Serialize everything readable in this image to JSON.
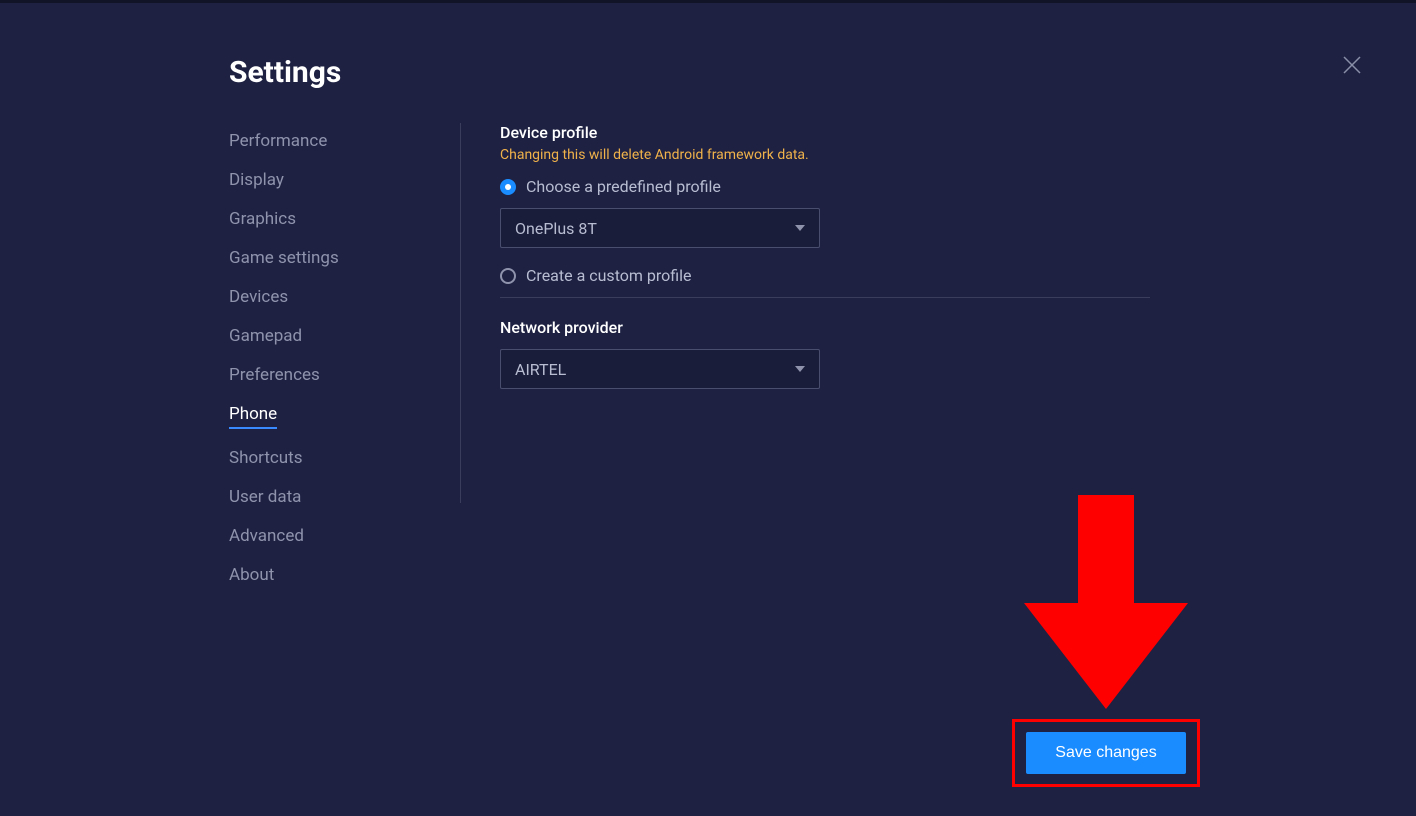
{
  "title": "Settings",
  "sidebar": {
    "items": [
      {
        "label": "Performance"
      },
      {
        "label": "Display"
      },
      {
        "label": "Graphics"
      },
      {
        "label": "Game settings"
      },
      {
        "label": "Devices"
      },
      {
        "label": "Gamepad"
      },
      {
        "label": "Preferences"
      },
      {
        "label": "Phone"
      },
      {
        "label": "Shortcuts"
      },
      {
        "label": "User data"
      },
      {
        "label": "Advanced"
      },
      {
        "label": "About"
      }
    ],
    "active_index": 7
  },
  "device_profile": {
    "heading": "Device profile",
    "warning": "Changing this will delete Android framework data.",
    "option_predefined": "Choose a predefined profile",
    "option_custom": "Create a custom profile",
    "selected_profile": "OnePlus 8T"
  },
  "network_provider": {
    "heading": "Network provider",
    "selected": "AIRTEL"
  },
  "buttons": {
    "save": "Save changes"
  },
  "colors": {
    "bg": "#1e2142",
    "accent": "#1a8cff",
    "warning": "#f0b24a",
    "annotation": "#ff0000"
  }
}
